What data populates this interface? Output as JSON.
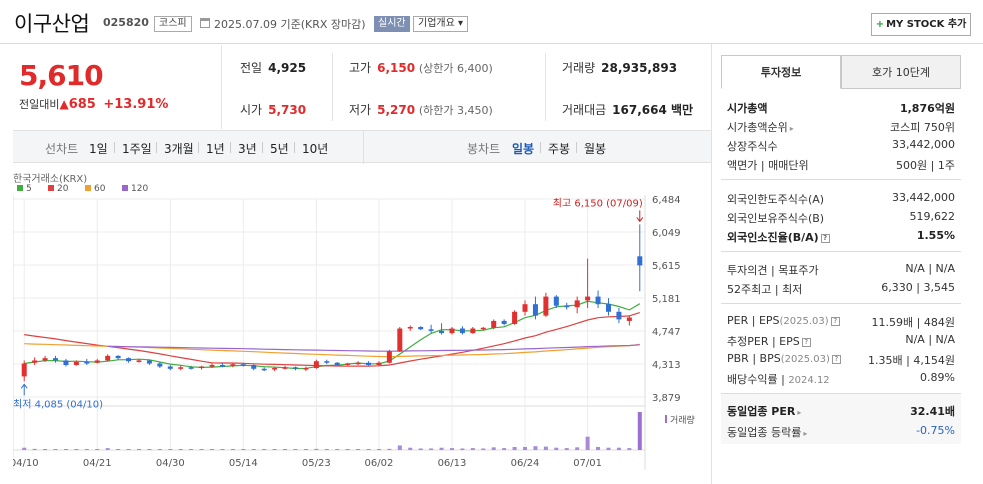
{
  "header": {
    "company": "이구산업",
    "code": "025820",
    "market": "코스피",
    "date_text": "2025.07.09 기준(KRX 장마감)",
    "live_label": "실시간",
    "company_info_label": "기업개요 ▾",
    "mystock_label": "MY STOCK 추가",
    "mystock_plus": "+"
  },
  "price": {
    "current": "5,610",
    "change_label": "전일대비",
    "change_arrow": "▲",
    "change_value": "685",
    "change_pct": "+13.91%"
  },
  "stats": {
    "prev_label": "전일",
    "prev_value": "4,925",
    "high_label": "고가",
    "high_value": "6,150",
    "high_limit": "(상한가 6,400)",
    "volume_label": "거래량",
    "volume_value": "28,935,893",
    "open_label": "시가",
    "open_value": "5,730",
    "low_label": "저가",
    "low_value": "5,270",
    "low_limit": "(하한가 3,450)",
    "amount_label": "거래대금",
    "amount_value": "167,664 백만"
  },
  "period_tabs": {
    "label": "선차트",
    "items": [
      "1일",
      "1주일",
      "3개월",
      "1년",
      "3년",
      "5년",
      "10년"
    ],
    "candle_label": "봉차트",
    "candle_items": [
      "일봉",
      "주봉",
      "월봉"
    ],
    "active_candle": "일봉"
  },
  "side_panel": {
    "tabs": [
      "투자정보",
      "호가 10단계"
    ],
    "rows": {
      "market_cap": {
        "k": "시가총액",
        "v": "1,876억원"
      },
      "cap_rank": {
        "k": "시가총액순위",
        "v": "코스피 750위"
      },
      "shares": {
        "k": "상장주식수",
        "v": "33,442,000"
      },
      "par_unit_k1": "액면가",
      "par_unit_k2": "매매단위",
      "par_unit_v1": "500원",
      "par_unit_v2": "1주",
      "foreign_limit": {
        "k": "외국인한도주식수(A)",
        "v": "33,442,000"
      },
      "foreign_hold": {
        "k": "외국인보유주식수(B)",
        "v": "519,622"
      },
      "foreign_rate": {
        "k": "외국인소진율(B/A)",
        "v": "1.55%"
      },
      "opinion_k1": "투자의견",
      "opinion_k2": "목표주가",
      "opinion_v1": "N/A",
      "opinion_v2": "N/A",
      "w52_k1": "52주최고",
      "w52_k2": "최저",
      "w52_v1": "6,330",
      "w52_v2": "3,545",
      "per_k1": "PER",
      "per_k2": "EPS",
      "per_date": "(2025.03)",
      "per_v1": "11.59배",
      "per_v2": "484원",
      "eper_k1": "추정PER",
      "eper_k2": "EPS",
      "eper_v1": "N/A",
      "eper_v2": "N/A",
      "pbr_k1": "PBR",
      "pbr_k2": "BPS",
      "pbr_date": "(2025.03)",
      "pbr_v1": "1.35배",
      "pbr_v2": "4,154원",
      "div_k": "배당수익률",
      "div_date": "2024.12",
      "div_v": "0.89%",
      "sector_per": {
        "k": "동일업종 PER",
        "v": "32.41배"
      },
      "sector_chg": {
        "k": "동일업종 등락률",
        "v": "-0.75%"
      }
    }
  },
  "chart_data": {
    "type": "candlestick",
    "source_label": "한국거래소(KRX)",
    "ma_legend": [
      {
        "name": "5",
        "color": "#3fae3f"
      },
      {
        "name": "20",
        "color": "#e04040"
      },
      {
        "name": "60",
        "color": "#f0a030"
      },
      {
        "name": "120",
        "color": "#9966cc"
      }
    ],
    "y_ticks": [
      "6,484",
      "6,049",
      "5,615",
      "5,181",
      "4,747",
      "4,313",
      "3,879"
    ],
    "y_range": [
      3879,
      6484
    ],
    "x_ticks": [
      {
        "label": "04/10",
        "i": 0
      },
      {
        "label": "04/21",
        "i": 7
      },
      {
        "label": "04/30",
        "i": 14
      },
      {
        "label": "05/14",
        "i": 21
      },
      {
        "label": "05/23",
        "i": 28
      },
      {
        "label": "06/02",
        "i": 34
      },
      {
        "label": "06/13",
        "i": 41
      },
      {
        "label": "06/24",
        "i": 48
      },
      {
        "label": "07/01",
        "i": 54
      }
    ],
    "max_label": "최고 6,150 (07/09)",
    "min_label": "최저 4,085 (04/10)",
    "volume_label": "거래량",
    "candles": [
      [
        4150,
        4360,
        4085,
        4320
      ],
      [
        4330,
        4400,
        4300,
        4360
      ],
      [
        4360,
        4420,
        4340,
        4390
      ],
      [
        4390,
        4420,
        4330,
        4360
      ],
      [
        4360,
        4380,
        4280,
        4300
      ],
      [
        4300,
        4360,
        4290,
        4340
      ],
      [
        4340,
        4380,
        4300,
        4330
      ],
      [
        4330,
        4380,
        4320,
        4360
      ],
      [
        4360,
        4440,
        4350,
        4420
      ],
      [
        4420,
        4430,
        4370,
        4390
      ],
      [
        4390,
        4400,
        4330,
        4350
      ],
      [
        4350,
        4380,
        4330,
        4360
      ],
      [
        4360,
        4370,
        4300,
        4320
      ],
      [
        4320,
        4340,
        4260,
        4280
      ],
      [
        4280,
        4300,
        4230,
        4250
      ],
      [
        4250,
        4290,
        4230,
        4270
      ],
      [
        4270,
        4290,
        4240,
        4260
      ],
      [
        4260,
        4290,
        4240,
        4280
      ],
      [
        4280,
        4320,
        4260,
        4300
      ],
      [
        4300,
        4330,
        4270,
        4290
      ],
      [
        4290,
        4320,
        4270,
        4310
      ],
      [
        4310,
        4330,
        4280,
        4300
      ],
      [
        4300,
        4310,
        4230,
        4250
      ],
      [
        4250,
        4270,
        4220,
        4240
      ],
      [
        4240,
        4270,
        4220,
        4260
      ],
      [
        4260,
        4290,
        4240,
        4270
      ],
      [
        4270,
        4280,
        4230,
        4250
      ],
      [
        4250,
        4280,
        4220,
        4260
      ],
      [
        4260,
        4370,
        4250,
        4350
      ],
      [
        4350,
        4370,
        4310,
        4330
      ],
      [
        4330,
        4340,
        4290,
        4300
      ],
      [
        4300,
        4330,
        4290,
        4320
      ],
      [
        4320,
        4350,
        4300,
        4330
      ],
      [
        4330,
        4350,
        4290,
        4300
      ],
      [
        4300,
        4350,
        4290,
        4330
      ],
      [
        4330,
        4500,
        4320,
        4480
      ],
      [
        4480,
        4800,
        4470,
        4780
      ],
      [
        4780,
        4820,
        4750,
        4800
      ],
      [
        4800,
        4810,
        4760,
        4770
      ],
      [
        4770,
        4830,
        4720,
        4750
      ],
      [
        4750,
        4850,
        4700,
        4720
      ],
      [
        4720,
        4800,
        4700,
        4780
      ],
      [
        4780,
        4810,
        4700,
        4720
      ],
      [
        4720,
        4800,
        4710,
        4780
      ],
      [
        4780,
        4800,
        4750,
        4790
      ],
      [
        4790,
        4900,
        4770,
        4880
      ],
      [
        4880,
        4900,
        4820,
        4840
      ],
      [
        4840,
        5020,
        4830,
        5000
      ],
      [
        5000,
        5150,
        4950,
        5100
      ],
      [
        5100,
        5200,
        4900,
        4950
      ],
      [
        4950,
        5250,
        4930,
        5200
      ],
      [
        5200,
        5220,
        5050,
        5080
      ],
      [
        5080,
        5120,
        5030,
        5060
      ],
      [
        5060,
        5200,
        4980,
        5150
      ],
      [
        5150,
        5700,
        5050,
        5200
      ],
      [
        5200,
        5280,
        5050,
        5100
      ],
      [
        5100,
        5180,
        4950,
        5000
      ],
      [
        5000,
        5050,
        4850,
        4900
      ],
      [
        4880,
        4950,
        4820,
        4925
      ],
      [
        5730,
        6150,
        5270,
        5610
      ]
    ],
    "volumes": [
      0.06,
      0.03,
      0.02,
      0.02,
      0.02,
      0.02,
      0.02,
      0.02,
      0.05,
      0.02,
      0.02,
      0.02,
      0.02,
      0.02,
      0.02,
      0.02,
      0.02,
      0.02,
      0.02,
      0.02,
      0.02,
      0.02,
      0.02,
      0.02,
      0.02,
      0.02,
      0.02,
      0.02,
      0.03,
      0.02,
      0.02,
      0.02,
      0.02,
      0.02,
      0.02,
      0.03,
      0.12,
      0.06,
      0.04,
      0.04,
      0.06,
      0.05,
      0.04,
      0.05,
      0.04,
      0.07,
      0.05,
      0.08,
      0.08,
      0.1,
      0.09,
      0.06,
      0.05,
      0.07,
      0.35,
      0.08,
      0.06,
      0.06,
      0.05,
      1.0
    ]
  }
}
